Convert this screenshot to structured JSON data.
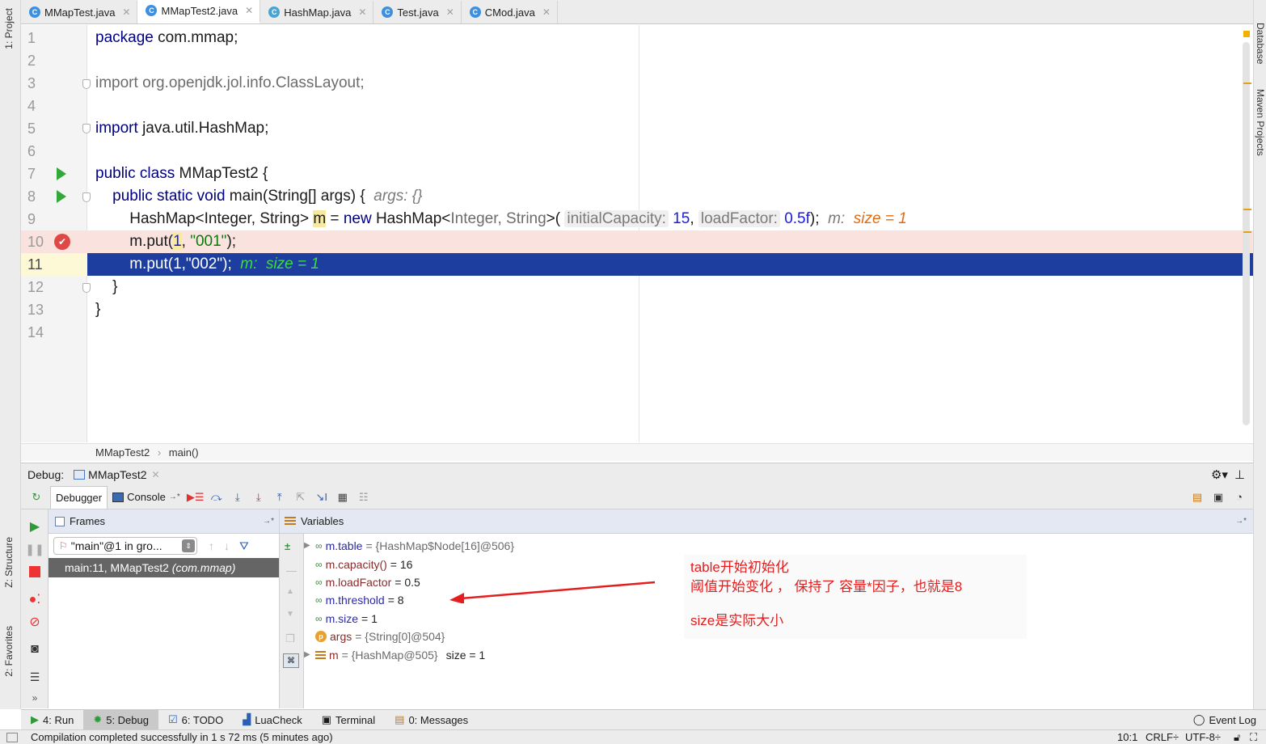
{
  "left_strip": {
    "project": "1: Project",
    "structure": "Z: Structure",
    "favorites": "2: Favorites"
  },
  "right_strip": {
    "database": "Database",
    "maven": "Maven Projects"
  },
  "tabs": [
    {
      "label": "MMapTest.java",
      "active": false
    },
    {
      "label": "MMapTest2.java",
      "active": true
    },
    {
      "label": "HashMap.java",
      "active": false
    },
    {
      "label": "Test.java",
      "active": false
    },
    {
      "label": "CMod.java",
      "active": false
    }
  ],
  "editor": {
    "line_numbers": [
      "1",
      "2",
      "3",
      "4",
      "5",
      "6",
      "7",
      "8",
      "9",
      "10",
      "11",
      "12",
      "13",
      "14"
    ],
    "l1_kw": "package",
    "l1_rest": " com.mmap;",
    "l3_kw": "import",
    "l3_rest": " org.openjdk.jol.info.ClassLayout;",
    "l5_kw": "import",
    "l5_rest": " java.util.HashMap;",
    "l7_kw": "public class",
    "l7_rest": " MMapTest2 {",
    "l8_kw": "public static void",
    "l8_rest": " main(String[] args) {",
    "l8_hint": "args: {}",
    "l9_a": "HashMap<Integer, String> ",
    "l9_m": "m",
    "l9_b": " = ",
    "l9_new": "new",
    "l9_c": " HashMap<",
    "l9_gen": "Integer, String",
    "l9_d": ">(",
    "l9_h1": "initialCapacity:",
    "l9_v1": "15",
    "l9_comma": ",",
    "l9_h2": "loadFactor:",
    "l9_v2": "0.5f",
    "l9_end": ");",
    "l9_iname": "m:",
    "l9_ival": "size = 1",
    "l10_a": "m.put(",
    "l10_n": "1",
    "l10_b": ", ",
    "l10_s": "\"001\"",
    "l10_c": ");",
    "l11_code": "m.put(1,\"002\");",
    "l11_inline": "m:  size = 1",
    "l12": "}",
    "l13": "}"
  },
  "breadcrumb": {
    "class": "MMapTest2",
    "sep": "›",
    "method": "main()"
  },
  "debug": {
    "label": "Debug:",
    "session": "MMapTest2",
    "tab_debugger": "Debugger",
    "tab_console": "Console",
    "frames_title": "Frames",
    "variables_title": "Variables",
    "thread": "\"main\"@1 in gro...",
    "frame": "main:11, MMapTest2",
    "frame_pkg": "(com.mmap)",
    "vars": [
      {
        "name": "m.table",
        "value": "= {HashMap$Node[16]@506}",
        "expandable": true
      },
      {
        "name": "m.capacity()",
        "value": "= 16",
        "expandable": false
      },
      {
        "name": "m.loadFactor",
        "value": "= 0.5",
        "expandable": false
      },
      {
        "name": "m.threshold",
        "value": "= 8",
        "expandable": false
      },
      {
        "name": "m.size",
        "value": "= 1",
        "expandable": false
      },
      {
        "name": "args",
        "value": "= {String[0]@504}",
        "expandable": false
      },
      {
        "name": "m",
        "value": "= {HashMap@505}",
        "extra": "size = 1",
        "expandable": true
      }
    ]
  },
  "annotation": {
    "line1": "table开始初始化",
    "line2": "阈值开始变化 ， 保持了  容量*因子，也就是8",
    "line3": "size是实际大小"
  },
  "toolwindows": {
    "run": "4: Run",
    "debug": "5: Debug",
    "todo": "6: TODO",
    "luacheck": "LuaCheck",
    "terminal": "Terminal",
    "messages": "0: Messages",
    "eventlog": "Event Log"
  },
  "status": {
    "message": "Compilation completed successfully in 1 s 72 ms (5 minutes ago)",
    "position": "10:1",
    "line_sep": "CRLF÷",
    "encoding": "UTF-8÷"
  },
  "colors": {
    "current_line": "#1d3e9e",
    "breakpoint_line": "#fae3df",
    "annotation": "#e41d1d"
  }
}
